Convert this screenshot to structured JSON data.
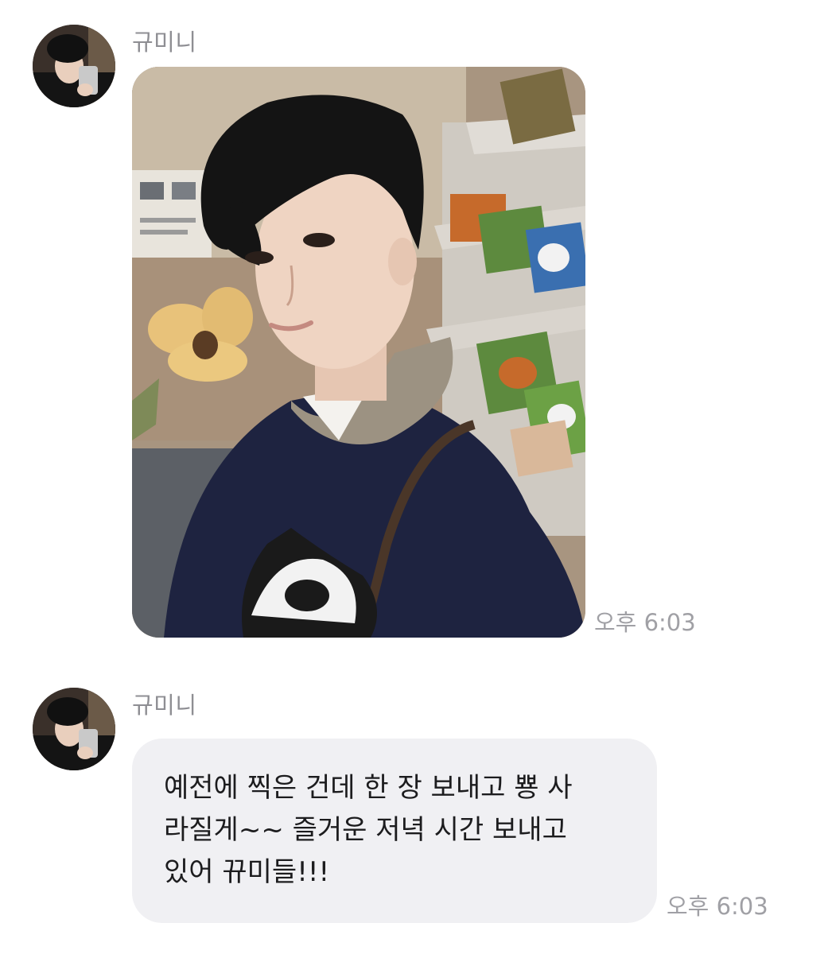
{
  "messages": [
    {
      "sender": "규미니",
      "avatar_icon": "profile-photo",
      "type": "image",
      "image_description": "selfie-photo",
      "time": "오후 6:03"
    },
    {
      "sender": "규미니",
      "avatar_icon": "profile-photo",
      "type": "text",
      "lines": [
        "예전에 찍은 건데 한 장 보내고 뿅 사",
        "라질게~~ 즐거운 저녁 시간 보내고",
        "있어 뀨미들!!!"
      ],
      "time": "오후 6:03"
    }
  ],
  "colors": {
    "background": "#ffffff",
    "bubble": "#f0f0f3",
    "sender_name": "#8e8e93",
    "timestamp": "#a0a0a5",
    "message_text": "#1c1c1e"
  }
}
